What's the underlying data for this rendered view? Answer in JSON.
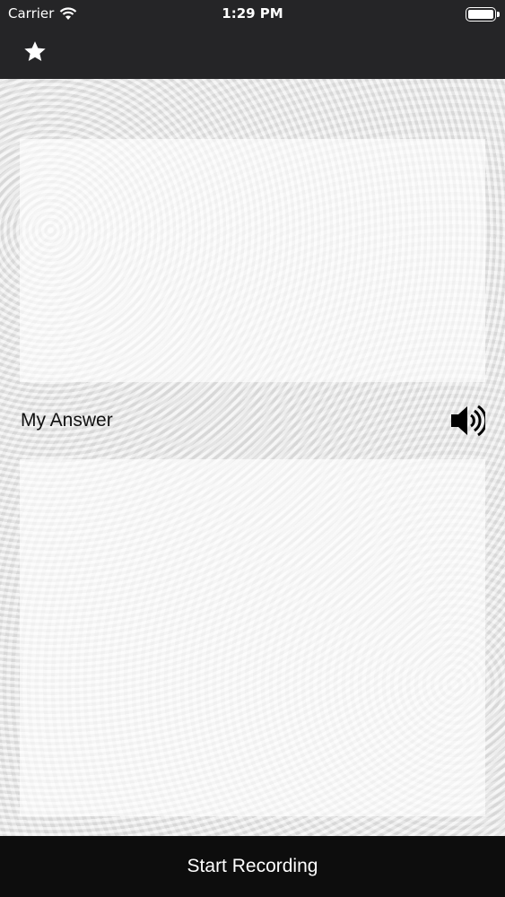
{
  "status_bar": {
    "carrier": "Carrier",
    "time": "1:29 PM"
  },
  "nav": {
    "favorite_icon": "star-icon"
  },
  "answer_section": {
    "label": "My Answer",
    "speaker_icon": "speaker-icon"
  },
  "bottom": {
    "record_label": "Start Recording"
  }
}
